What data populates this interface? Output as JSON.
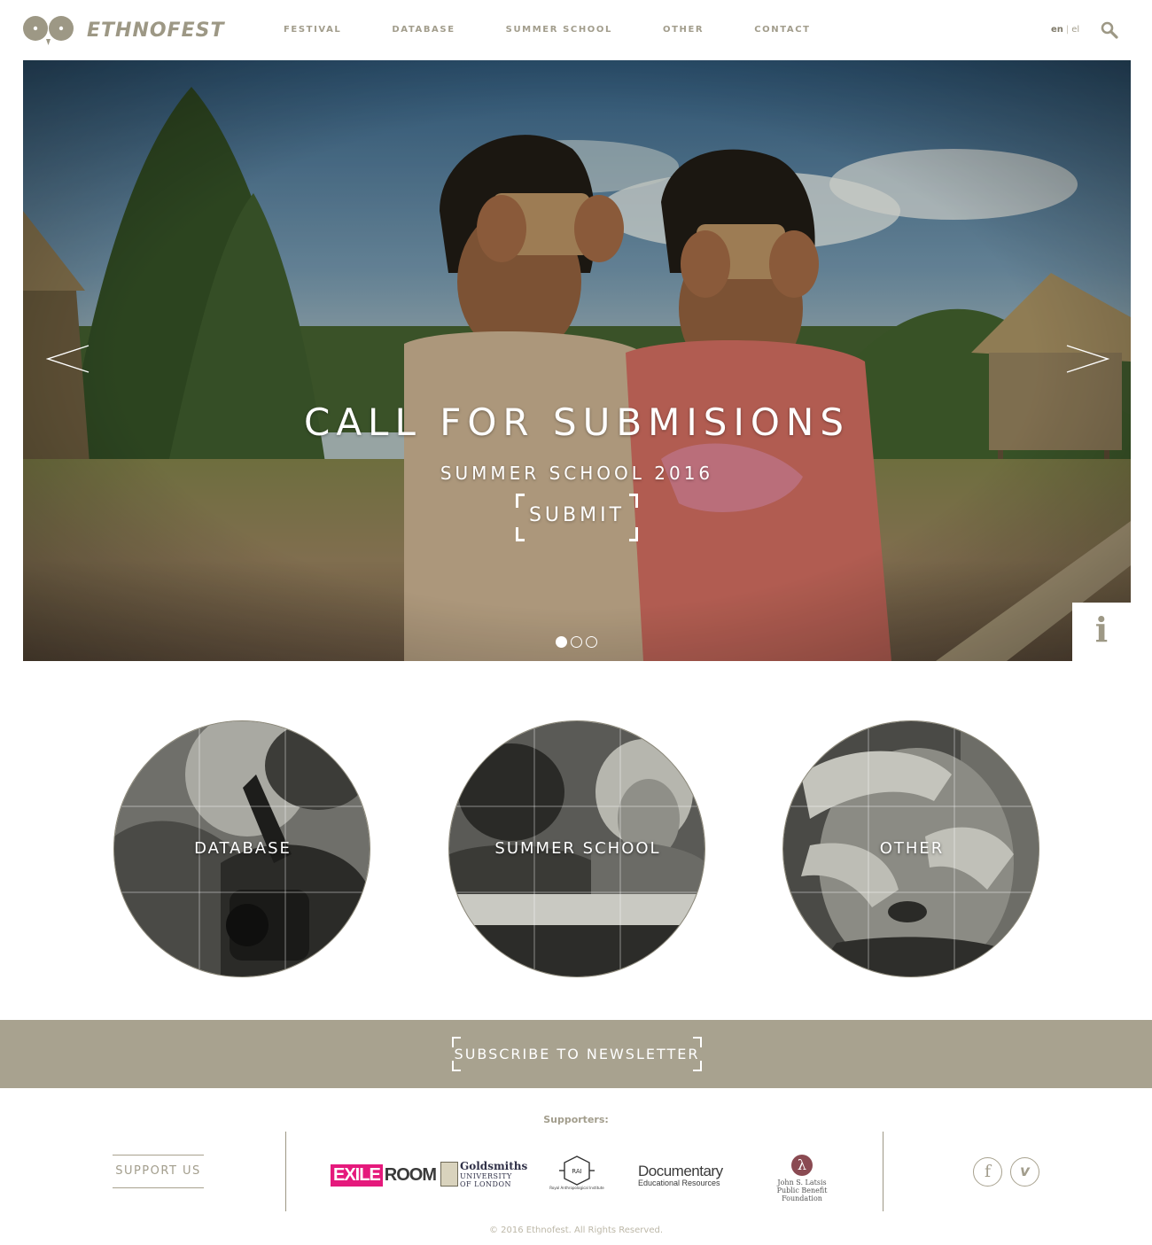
{
  "header": {
    "logo_text": "ETHNOFEST",
    "nav": [
      "FESTIVAL",
      "DATABASE",
      "SUMMER SCHOOL",
      "OTHER",
      "CONTACT"
    ],
    "lang_active": "en",
    "lang_sep": "|",
    "lang_other": "el"
  },
  "hero": {
    "title": "CALL FOR SUBMISIONS",
    "subtitle": "SUMMER SCHOOL 2016",
    "submit_label": "SUBMIT",
    "slide_count": 3,
    "active_slide": 1,
    "info_glyph": "i"
  },
  "sections": [
    {
      "label": "DATABASE"
    },
    {
      "label": "SUMMER SCHOOL"
    },
    {
      "label": "OTHER"
    }
  ],
  "newsletter": {
    "label": "SUBSCRIBE TO NEWSLETTER",
    "bg_color": "#a8a28f"
  },
  "footer": {
    "support_label": "SUPPORT US",
    "supporters_title": "Supporters:",
    "sponsors": {
      "exile_a": "EXILE",
      "exile_b": "ROOM",
      "goldsmiths_name": "Goldsmiths",
      "goldsmiths_sub": "UNIVERSITY OF LONDON",
      "rai_mark": "RAI",
      "rai_sub": "Royal Anthropological Institute",
      "doc_name": "Documentary",
      "doc_sub": "Educational Resources",
      "latsis_mark": "λ",
      "latsis_line1": "John S. Latsis",
      "latsis_line2": "Public Benefit Foundation"
    },
    "facebook_glyph": "f",
    "vimeo_glyph": "v",
    "copyright": "© 2016 Ethnofest. All Rights Reserved."
  },
  "colors": {
    "brand": "#9d9885",
    "exile_pink": "#e5197c"
  }
}
